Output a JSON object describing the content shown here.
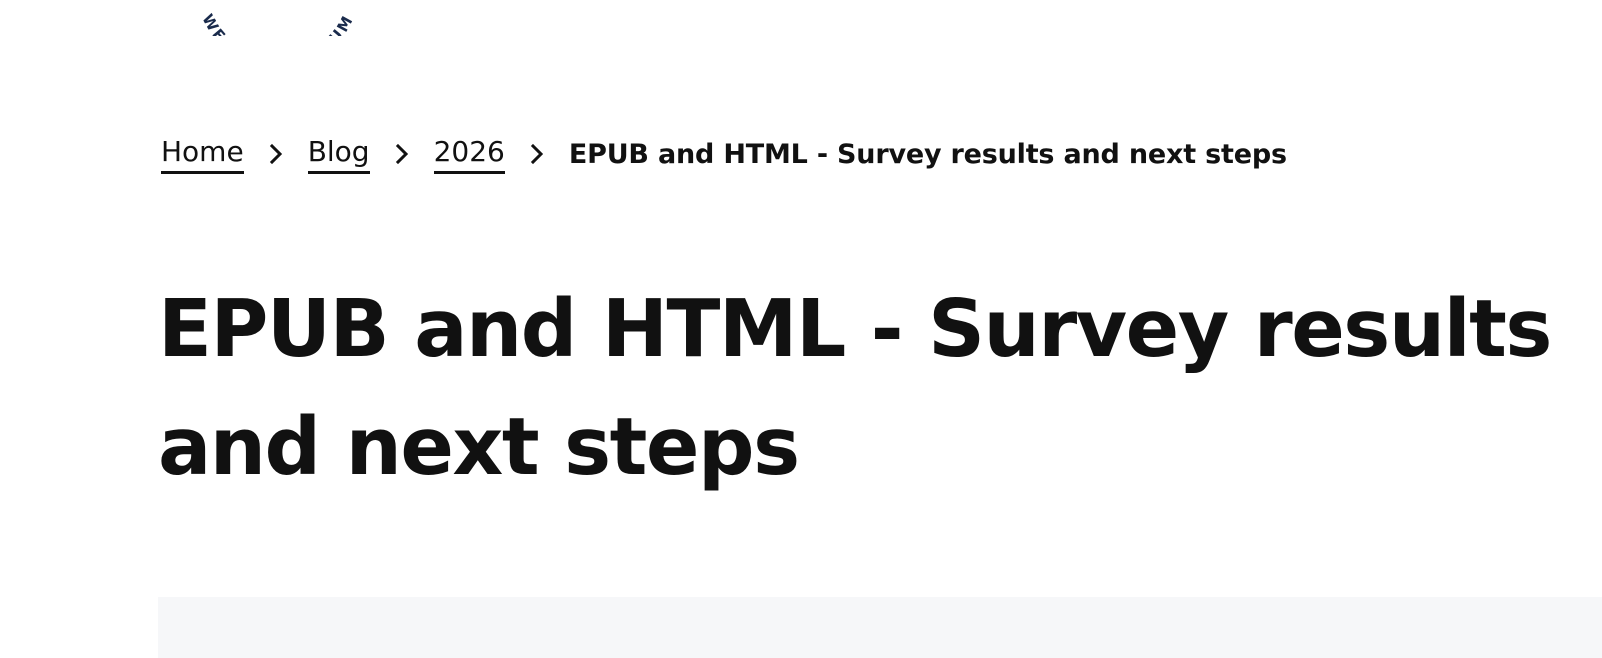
{
  "logo": {
    "arc_text": "WEB CONSORTIUM",
    "color": "#1a2b4c"
  },
  "breadcrumb": {
    "items": [
      {
        "label": "Home"
      },
      {
        "label": "Blog"
      },
      {
        "label": "2026"
      }
    ],
    "current": "EPUB and HTML - Survey results and next steps",
    "separator_icon": "chevron-right-icon"
  },
  "page": {
    "title": "EPUB and HTML - Survey results and next steps"
  },
  "colors": {
    "text": "#111111",
    "panel_background": "#f6f7f9"
  }
}
